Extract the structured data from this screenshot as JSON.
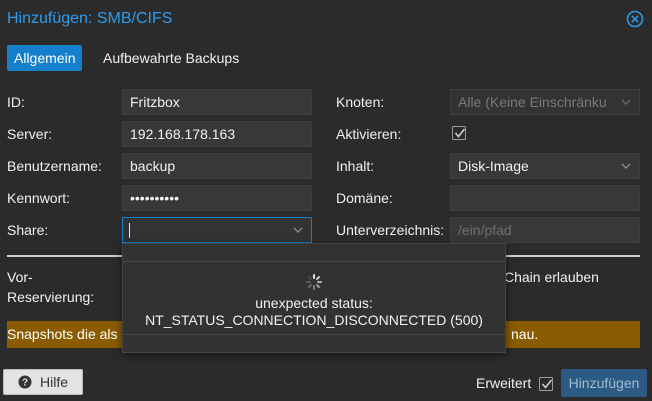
{
  "dialog": {
    "title": "Hinzufügen: SMB/CIFS"
  },
  "tabs": [
    {
      "label": "Allgemein"
    },
    {
      "label": "Aufbewahrte Backups"
    }
  ],
  "form": {
    "id": {
      "label": "ID:",
      "value": "Fritzbox"
    },
    "server": {
      "label": "Server:",
      "value": "192.168.178.163"
    },
    "username": {
      "label": "Benutzername:",
      "value": "backup"
    },
    "password": {
      "label": "Kennwort:",
      "value": "••••••••••"
    },
    "share": {
      "label": "Share:",
      "value": ""
    },
    "node": {
      "label": "Knoten:",
      "value": "Alle (Keine Einschränku"
    },
    "enable": {
      "label": "Aktivieren:",
      "checked": true
    },
    "content": {
      "label": "Inhalt:",
      "value": "Disk-Image"
    },
    "domain": {
      "label": "Domäne:",
      "value": ""
    },
    "subdir": {
      "label": "Unterverzeichnis:",
      "placeholder": "/ein/pfad"
    },
    "prealloc": {
      "label_line1": "Vor-",
      "label_line2": "Reservierung:"
    },
    "chain": {
      "label": "Chain erlauben"
    }
  },
  "warning": {
    "text_start": "Snapshots die als",
    "text_end": "nau."
  },
  "dropdown": {
    "status_line1": "unexpected status:",
    "status_line2": "NT_STATUS_CONNECTION_DISCONNECTED (500)"
  },
  "footer": {
    "help_label": "Hilfe",
    "advanced_label": "Erweitert",
    "advanced_checked": true,
    "add_label": "Hinzufügen"
  },
  "colors": {
    "accent": "#157fcc",
    "title": "#2d9cee",
    "warning": "#8a5b00",
    "background": "#2b2b2b"
  }
}
